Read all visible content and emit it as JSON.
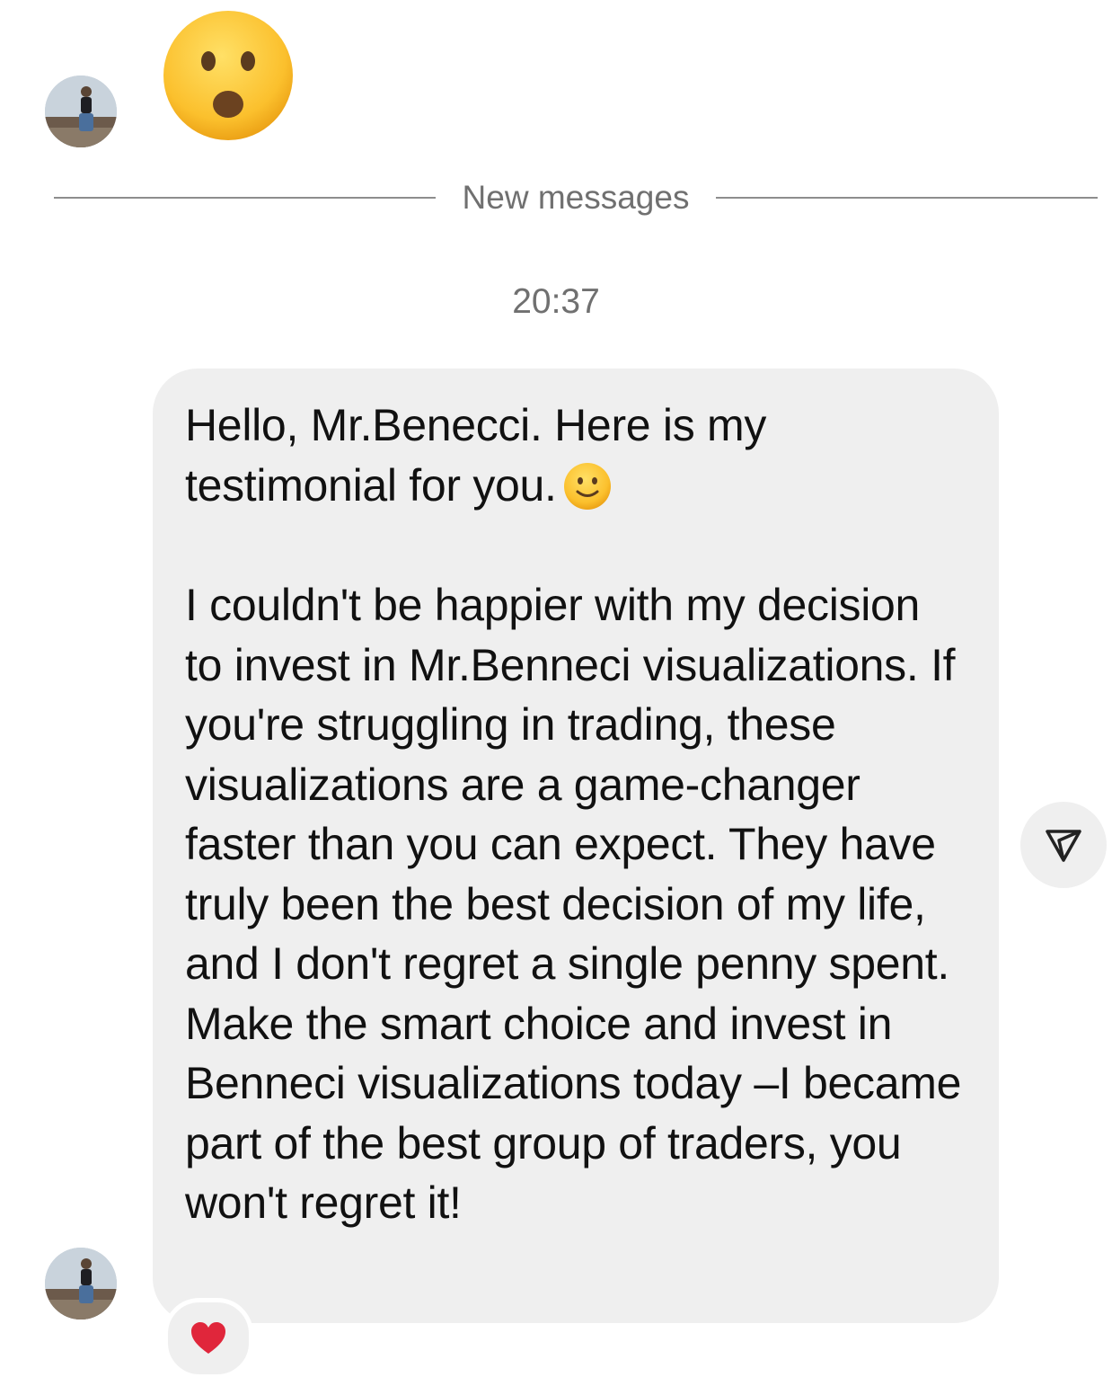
{
  "thread": {
    "top_emoji_icon": "astonished-face-emoji-icon",
    "divider_label": "New messages",
    "timestamp": "20:37"
  },
  "message": {
    "paragraph_1": "Hello, Mr.Benecci. Here is my testimonial for you.",
    "paragraph_1_emoji": "slightly-smiling-face-emoji-icon",
    "paragraph_2": "I couldn't be happier with my decision to invest in Mr.Benneci visualizations. If you're struggling in trading, these visualizations are a game-changer faster than you can expect. They have truly been the best decision of my life, and I don't regret a single penny spent. Make the smart choice and invest in Benneci visualizations today –I became part of the best group of traders, you won't regret it!",
    "reaction_icon": "red-heart-icon",
    "share_icon": "send-icon"
  },
  "colors": {
    "bubble_background": "#efefef",
    "secondary_text": "#707070",
    "heart": "#e0263b",
    "emoji_yellow": "#fbc02d"
  }
}
